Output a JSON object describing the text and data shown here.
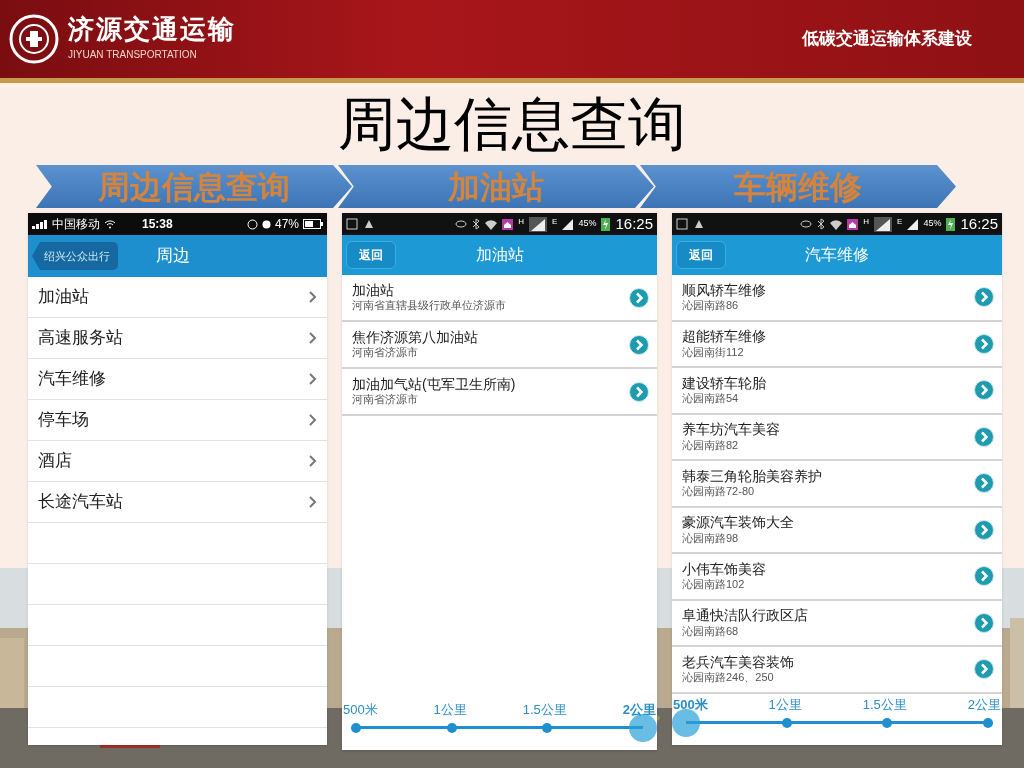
{
  "header": {
    "logo_text": "济源交通运输",
    "logo_subtext": "JIYUAN TRANSPORTATION",
    "tagline": "低碳交通运输体系建设"
  },
  "title": "周边信息查询",
  "steps": [
    {
      "label": "周边信息查询"
    },
    {
      "label": "加油站"
    },
    {
      "label": "车辆维修"
    }
  ],
  "phones": [
    {
      "kind": "ios-menu",
      "status": {
        "carrier": "中国移动",
        "time": "15:38",
        "battery": "47%"
      },
      "nav": {
        "back": "绍兴公众出行",
        "title": "周边"
      },
      "items": [
        {
          "label": "加油站"
        },
        {
          "label": "高速服务站"
        },
        {
          "label": "汽车维修"
        },
        {
          "label": "停车场"
        },
        {
          "label": "酒店"
        },
        {
          "label": "长途汽车站"
        }
      ]
    },
    {
      "kind": "android-list",
      "status": {
        "network_labels": [
          "H",
          "E"
        ],
        "battery": "45%",
        "time": "16:25"
      },
      "nav": {
        "back": "返回",
        "title": "加油站"
      },
      "items": [
        {
          "name": "加油站",
          "address": "河南省直辖县级行政单位济源市"
        },
        {
          "name": "焦作济源第八加油站",
          "address": "河南省济源市"
        },
        {
          "name": "加油加气站(屯军卫生所南)",
          "address": "河南省济源市"
        }
      ],
      "distance_stops": [
        {
          "label": "500米",
          "selected": false
        },
        {
          "label": "1公里",
          "selected": false
        },
        {
          "label": "1.5公里",
          "selected": false
        },
        {
          "label": "2公里",
          "selected": true
        }
      ]
    },
    {
      "kind": "android-list",
      "status": {
        "network_labels": [
          "H",
          "E"
        ],
        "battery": "45%",
        "time": "16:25"
      },
      "nav": {
        "back": "返回",
        "title": "汽车维修"
      },
      "items": [
        {
          "name": "顺风轿车维修",
          "address": "沁园南路86"
        },
        {
          "name": "超能轿车维修",
          "address": "沁园南街112"
        },
        {
          "name": "建设轿车轮胎",
          "address": "沁园南路54"
        },
        {
          "name": "养车坊汽车美容",
          "address": "沁园南路82"
        },
        {
          "name": "韩泰三角轮胎美容养护",
          "address": "沁园南路72-80"
        },
        {
          "name": "豪源汽车装饰大全",
          "address": "沁园南路98"
        },
        {
          "name": "小伟车饰美容",
          "address": "沁园南路102"
        },
        {
          "name": "阜通快洁队行政区店",
          "address": "沁园南路68"
        },
        {
          "name": "老兵汽车美容装饰",
          "address": "沁园南路246、250"
        }
      ],
      "distance_stops": [
        {
          "label": "500米",
          "selected": true
        },
        {
          "label": "1公里",
          "selected": false
        },
        {
          "label": "1.5公里",
          "selected": false
        },
        {
          "label": "2公里",
          "selected": false
        }
      ]
    }
  ]
}
